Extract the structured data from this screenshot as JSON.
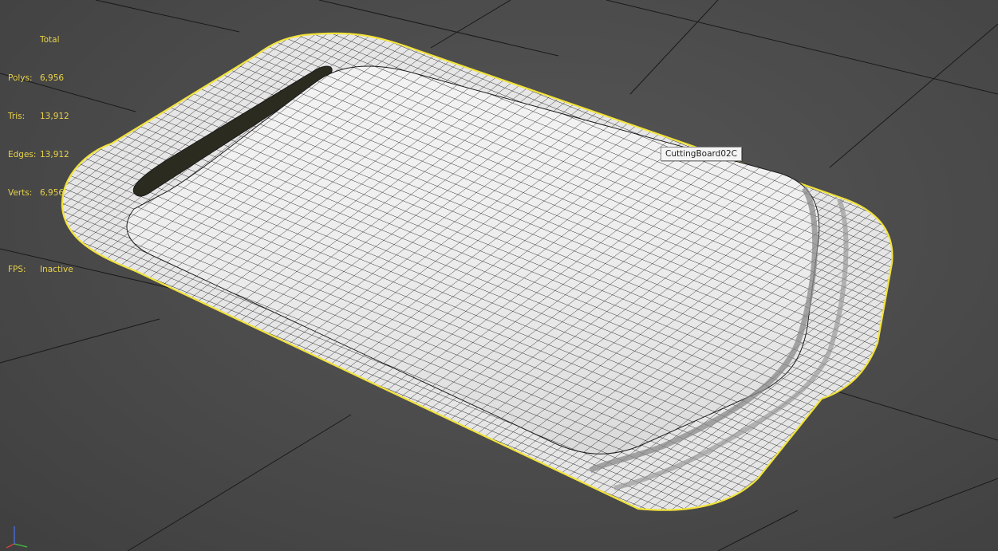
{
  "viewport": {
    "stats": {
      "header": "Total",
      "rows": [
        {
          "label": "Polys:",
          "value": "6,956"
        },
        {
          "label": "Tris:",
          "value": "13,912"
        },
        {
          "label": "Edges:",
          "value": "13,912"
        },
        {
          "label": "Verts:",
          "value": "6,956"
        }
      ],
      "fps_label": "FPS:",
      "fps_value": "Inactive"
    },
    "object_tooltip": "CuttingBoard02C",
    "colors": {
      "background": "#4b4b4b",
      "grid_line": "#1a1a1a",
      "stats_text": "#e8d24a",
      "selection_outline": "#f2e33a",
      "mesh_fill": "#f2f2f2",
      "wire": "#1b1b1b"
    },
    "gizmo": {
      "axes": [
        "x",
        "y",
        "z"
      ],
      "colors": {
        "x": "#d84040",
        "y": "#40c040",
        "z": "#4a6bd8"
      }
    }
  }
}
